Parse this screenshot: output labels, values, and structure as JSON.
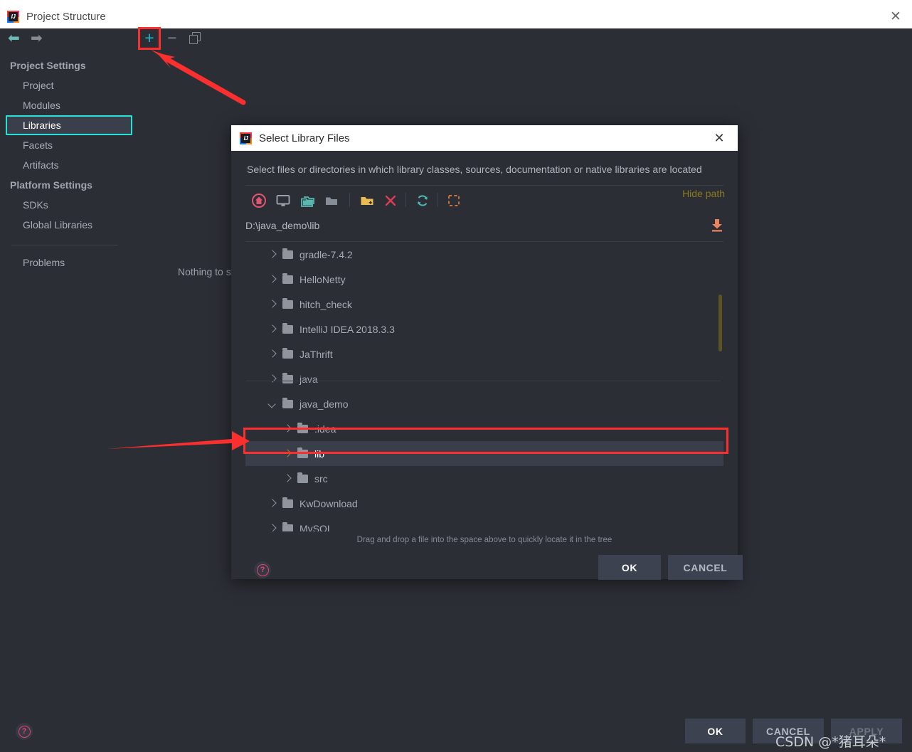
{
  "main_window": {
    "title": "Project Structure",
    "ghost_top_text": "",
    "close_icon": "✕",
    "toolbar": {
      "back_icon": "⬅",
      "forward_icon": "➡",
      "add_label": "+",
      "remove_label": "−",
      "copy_icon": "copy-icon"
    },
    "sidebar": {
      "groups": [
        {
          "label": "Project Settings",
          "items": [
            {
              "label": "Project",
              "selected": false
            },
            {
              "label": "Modules",
              "selected": false
            },
            {
              "label": "Libraries",
              "selected": true
            },
            {
              "label": "Facets",
              "selected": false
            },
            {
              "label": "Artifacts",
              "selected": false
            }
          ]
        },
        {
          "label": "Platform Settings",
          "items": [
            {
              "label": "SDKs",
              "selected": false
            },
            {
              "label": "Global Libraries",
              "selected": false
            }
          ]
        }
      ],
      "problems_label": "Problems"
    },
    "content_placeholder": "Nothing to s",
    "help_icon": "?",
    "buttons": {
      "ok": "OK",
      "cancel": "CANCEL",
      "apply": "APPLY"
    }
  },
  "dialog": {
    "title": "Select Library Files",
    "close_icon": "✕",
    "description": "Select files or directories in which library classes, sources, documentation or native libraries are located",
    "toolbar_icons": [
      "home-icon",
      "desktop-icon",
      "folders-icon",
      "folder-icon",
      "new-folder-icon",
      "delete-icon",
      "refresh-icon",
      "select-area-icon"
    ],
    "hide_path_label": "Hide path",
    "path_value": "D:\\java_demo\\lib",
    "download_icon": "download-icon",
    "tree": [
      {
        "label": "gradle-7.4.2",
        "depth": 1,
        "expanded": false,
        "selected": false
      },
      {
        "label": "HelloNetty",
        "depth": 1,
        "expanded": false,
        "selected": false
      },
      {
        "label": "hitch_check",
        "depth": 1,
        "expanded": false,
        "selected": false
      },
      {
        "label": "IntelliJ IDEA 2018.3.3",
        "depth": 1,
        "expanded": false,
        "selected": false
      },
      {
        "label": "JaThrift",
        "depth": 1,
        "expanded": false,
        "selected": false
      },
      {
        "label": "java",
        "depth": 1,
        "expanded": false,
        "selected": false
      },
      {
        "label": "java_demo",
        "depth": 1,
        "expanded": true,
        "selected": false
      },
      {
        "label": ".idea",
        "depth": 2,
        "expanded": false,
        "selected": false
      },
      {
        "label": "lib",
        "depth": 2,
        "expanded": false,
        "selected": true
      },
      {
        "label": "src",
        "depth": 2,
        "expanded": false,
        "selected": false
      },
      {
        "label": "KwDownload",
        "depth": 1,
        "expanded": false,
        "selected": false
      },
      {
        "label": "MySQL",
        "depth": 1,
        "expanded": false,
        "selected": false
      }
    ],
    "drag_hint": "Drag and drop a file into the space above to quickly locate it in the tree",
    "help_icon": "?",
    "buttons": {
      "ok": "OK",
      "cancel": "CANCEL"
    }
  },
  "annotations": {
    "highlight_color": "#fc2f2f",
    "selection_color": "#27e0d8",
    "arrow_to_add_button": "arrow-icon",
    "arrow_to_lib_row": "arrow-icon"
  },
  "watermark": "CSDN @*猪耳朵*"
}
